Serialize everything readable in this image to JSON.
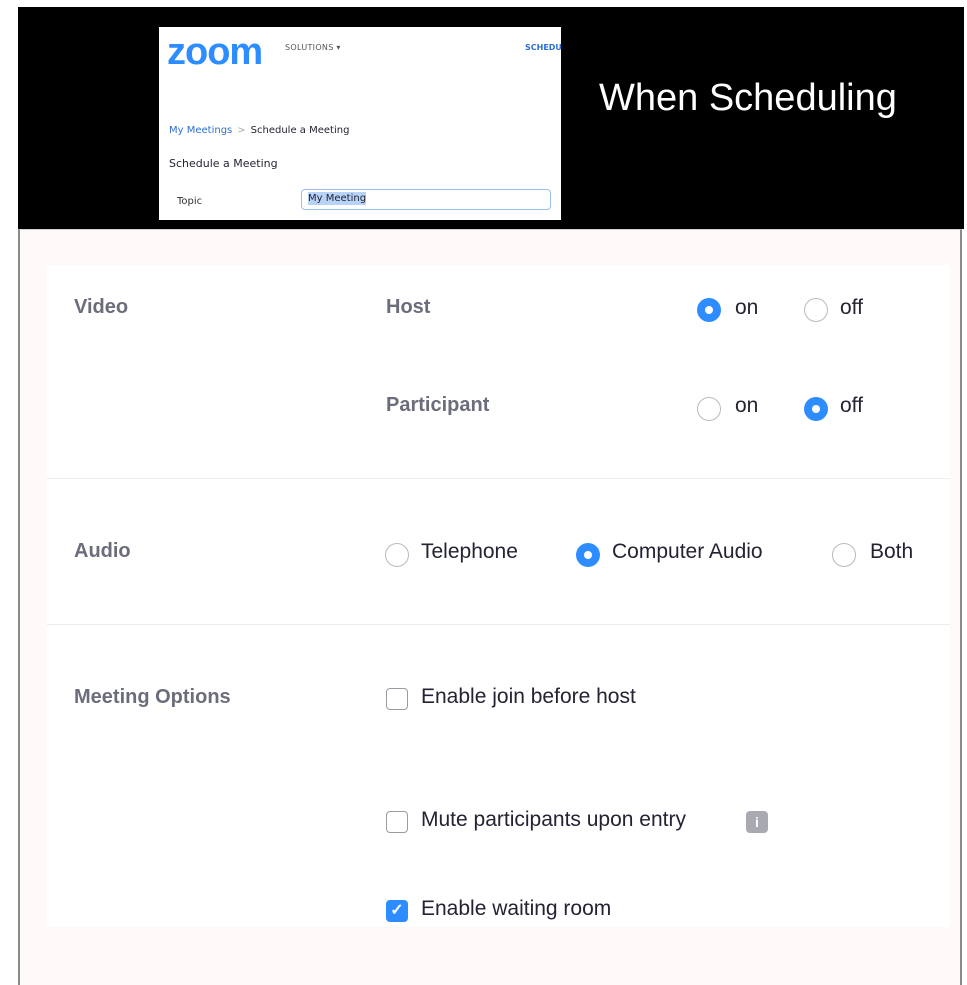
{
  "banner": {
    "title": "When Scheduling",
    "zoom_logo": "zoom",
    "solutions_menu": "SOLUTIONS ▾",
    "schedule_link": "SCHEDULE",
    "breadcrumb": {
      "link": "My Meetings",
      "separator": ">",
      "current": "Schedule a Meeting"
    },
    "page_title": "Schedule a Meeting",
    "topic_label": "Topic",
    "topic_value": "My Meeting"
  },
  "settings": {
    "video": {
      "label": "Video",
      "host": {
        "label": "Host",
        "on_label": "on",
        "off_label": "off",
        "selected": "on"
      },
      "participant": {
        "label": "Participant",
        "on_label": "on",
        "off_label": "off",
        "selected": "off"
      }
    },
    "audio": {
      "label": "Audio",
      "options": [
        "Telephone",
        "Computer Audio",
        "Both"
      ],
      "selected": "Computer Audio"
    },
    "meeting_options": {
      "label": "Meeting Options",
      "items": [
        {
          "label": "Enable join before host",
          "checked": false
        },
        {
          "label": "Mute participants upon entry",
          "checked": false,
          "has_info_icon": true
        },
        {
          "label": "Enable waiting room",
          "checked": true
        }
      ]
    }
  },
  "colors": {
    "accent": "#2d8cff",
    "label_gray": "#6b6d7c",
    "text": "#232333"
  },
  "icons": {
    "check": "check-icon",
    "info": "info-badge-icon"
  }
}
